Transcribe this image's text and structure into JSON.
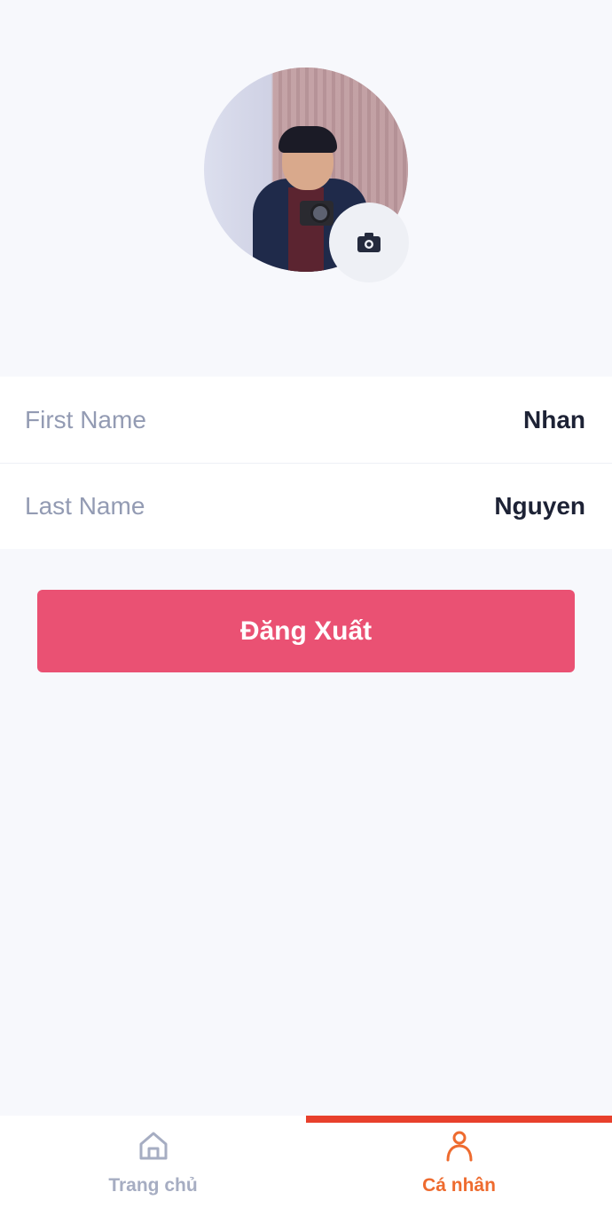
{
  "profile": {
    "avatar_alt": "Profile photo",
    "change_photo_icon": "camera-icon"
  },
  "fields": [
    {
      "label": "First Name",
      "value": "Nhan"
    },
    {
      "label": "Last Name",
      "value": "Nguyen"
    }
  ],
  "logout_label": "Đăng Xuất",
  "tabbar": {
    "tabs": [
      {
        "label": "Trang chủ",
        "icon": "home-icon",
        "active": false
      },
      {
        "label": "Cá nhân",
        "icon": "person-icon",
        "active": true
      }
    ]
  },
  "colors": {
    "background": "#f7f8fc",
    "logout_button": "#ea5173",
    "active_tab": "#ee6b2f",
    "active_indicator": "#e8402c",
    "inactive_tab": "#a6adc2"
  }
}
